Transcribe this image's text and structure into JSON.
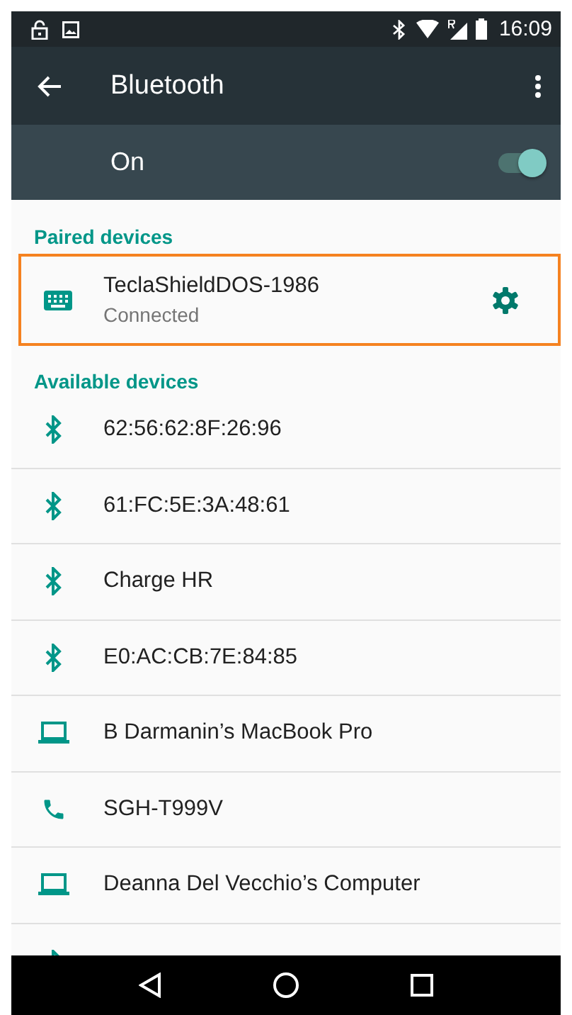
{
  "status_bar": {
    "time": "16:09"
  },
  "toolbar": {
    "title": "Bluetooth"
  },
  "master_switch": {
    "label": "On",
    "on": true
  },
  "paired": {
    "header": "Paired devices",
    "devices": [
      {
        "kind": "keyboard",
        "name": "TeclaShieldDOS-1986",
        "status": "Connected",
        "highlighted": true
      }
    ]
  },
  "available": {
    "header": "Available devices",
    "devices": [
      {
        "kind": "bluetooth",
        "name": "62:56:62:8F:26:96"
      },
      {
        "kind": "bluetooth",
        "name": "61:FC:5E:3A:48:61"
      },
      {
        "kind": "bluetooth",
        "name": "Charge HR"
      },
      {
        "kind": "bluetooth",
        "name": "E0:AC:CB:7E:84:85"
      },
      {
        "kind": "laptop",
        "name": "B Darmanin’s MacBook Pro"
      },
      {
        "kind": "phone",
        "name": "SGH-T999V"
      },
      {
        "kind": "laptop",
        "name": "Deanna Del Vecchio’s Computer"
      }
    ],
    "partial_row": {
      "kind": "bluetooth"
    }
  }
}
